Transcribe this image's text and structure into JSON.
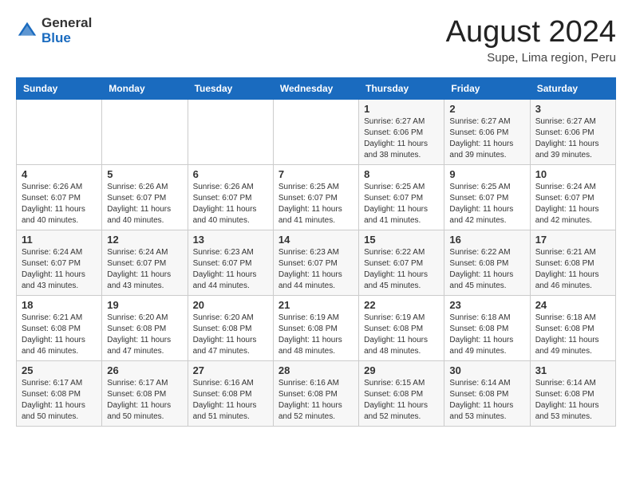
{
  "logo": {
    "general": "General",
    "blue": "Blue"
  },
  "title": "August 2024",
  "location": "Supe, Lima region, Peru",
  "days_of_week": [
    "Sunday",
    "Monday",
    "Tuesday",
    "Wednesday",
    "Thursday",
    "Friday",
    "Saturday"
  ],
  "weeks": [
    [
      {
        "day": "",
        "info": ""
      },
      {
        "day": "",
        "info": ""
      },
      {
        "day": "",
        "info": ""
      },
      {
        "day": "",
        "info": ""
      },
      {
        "day": "1",
        "info": "Sunrise: 6:27 AM\nSunset: 6:06 PM\nDaylight: 11 hours\nand 38 minutes."
      },
      {
        "day": "2",
        "info": "Sunrise: 6:27 AM\nSunset: 6:06 PM\nDaylight: 11 hours\nand 39 minutes."
      },
      {
        "day": "3",
        "info": "Sunrise: 6:27 AM\nSunset: 6:06 PM\nDaylight: 11 hours\nand 39 minutes."
      }
    ],
    [
      {
        "day": "4",
        "info": "Sunrise: 6:26 AM\nSunset: 6:07 PM\nDaylight: 11 hours\nand 40 minutes."
      },
      {
        "day": "5",
        "info": "Sunrise: 6:26 AM\nSunset: 6:07 PM\nDaylight: 11 hours\nand 40 minutes."
      },
      {
        "day": "6",
        "info": "Sunrise: 6:26 AM\nSunset: 6:07 PM\nDaylight: 11 hours\nand 40 minutes."
      },
      {
        "day": "7",
        "info": "Sunrise: 6:25 AM\nSunset: 6:07 PM\nDaylight: 11 hours\nand 41 minutes."
      },
      {
        "day": "8",
        "info": "Sunrise: 6:25 AM\nSunset: 6:07 PM\nDaylight: 11 hours\nand 41 minutes."
      },
      {
        "day": "9",
        "info": "Sunrise: 6:25 AM\nSunset: 6:07 PM\nDaylight: 11 hours\nand 42 minutes."
      },
      {
        "day": "10",
        "info": "Sunrise: 6:24 AM\nSunset: 6:07 PM\nDaylight: 11 hours\nand 42 minutes."
      }
    ],
    [
      {
        "day": "11",
        "info": "Sunrise: 6:24 AM\nSunset: 6:07 PM\nDaylight: 11 hours\nand 43 minutes."
      },
      {
        "day": "12",
        "info": "Sunrise: 6:24 AM\nSunset: 6:07 PM\nDaylight: 11 hours\nand 43 minutes."
      },
      {
        "day": "13",
        "info": "Sunrise: 6:23 AM\nSunset: 6:07 PM\nDaylight: 11 hours\nand 44 minutes."
      },
      {
        "day": "14",
        "info": "Sunrise: 6:23 AM\nSunset: 6:07 PM\nDaylight: 11 hours\nand 44 minutes."
      },
      {
        "day": "15",
        "info": "Sunrise: 6:22 AM\nSunset: 6:07 PM\nDaylight: 11 hours\nand 45 minutes."
      },
      {
        "day": "16",
        "info": "Sunrise: 6:22 AM\nSunset: 6:08 PM\nDaylight: 11 hours\nand 45 minutes."
      },
      {
        "day": "17",
        "info": "Sunrise: 6:21 AM\nSunset: 6:08 PM\nDaylight: 11 hours\nand 46 minutes."
      }
    ],
    [
      {
        "day": "18",
        "info": "Sunrise: 6:21 AM\nSunset: 6:08 PM\nDaylight: 11 hours\nand 46 minutes."
      },
      {
        "day": "19",
        "info": "Sunrise: 6:20 AM\nSunset: 6:08 PM\nDaylight: 11 hours\nand 47 minutes."
      },
      {
        "day": "20",
        "info": "Sunrise: 6:20 AM\nSunset: 6:08 PM\nDaylight: 11 hours\nand 47 minutes."
      },
      {
        "day": "21",
        "info": "Sunrise: 6:19 AM\nSunset: 6:08 PM\nDaylight: 11 hours\nand 48 minutes."
      },
      {
        "day": "22",
        "info": "Sunrise: 6:19 AM\nSunset: 6:08 PM\nDaylight: 11 hours\nand 48 minutes."
      },
      {
        "day": "23",
        "info": "Sunrise: 6:18 AM\nSunset: 6:08 PM\nDaylight: 11 hours\nand 49 minutes."
      },
      {
        "day": "24",
        "info": "Sunrise: 6:18 AM\nSunset: 6:08 PM\nDaylight: 11 hours\nand 49 minutes."
      }
    ],
    [
      {
        "day": "25",
        "info": "Sunrise: 6:17 AM\nSunset: 6:08 PM\nDaylight: 11 hours\nand 50 minutes."
      },
      {
        "day": "26",
        "info": "Sunrise: 6:17 AM\nSunset: 6:08 PM\nDaylight: 11 hours\nand 50 minutes."
      },
      {
        "day": "27",
        "info": "Sunrise: 6:16 AM\nSunset: 6:08 PM\nDaylight: 11 hours\nand 51 minutes."
      },
      {
        "day": "28",
        "info": "Sunrise: 6:16 AM\nSunset: 6:08 PM\nDaylight: 11 hours\nand 52 minutes."
      },
      {
        "day": "29",
        "info": "Sunrise: 6:15 AM\nSunset: 6:08 PM\nDaylight: 11 hours\nand 52 minutes."
      },
      {
        "day": "30",
        "info": "Sunrise: 6:14 AM\nSunset: 6:08 PM\nDaylight: 11 hours\nand 53 minutes."
      },
      {
        "day": "31",
        "info": "Sunrise: 6:14 AM\nSunset: 6:08 PM\nDaylight: 11 hours\nand 53 minutes."
      }
    ]
  ]
}
